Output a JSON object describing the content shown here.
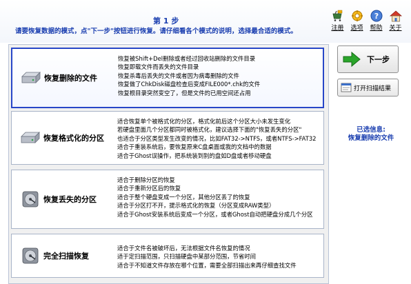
{
  "header": {
    "step_title": "第 1 步",
    "instruction": "请要恢复数据的模式，点\"下一步\"按钮进行恢复。请仔细看各个模式的说明，选择最合适的模式。"
  },
  "toolbar": [
    {
      "label": "注册",
      "icon": "register-icon"
    },
    {
      "label": "选项",
      "icon": "options-icon"
    },
    {
      "label": "帮助",
      "icon": "help-icon"
    },
    {
      "label": "关于",
      "icon": "about-icon"
    }
  ],
  "modes": [
    {
      "name": "恢复删除的文件",
      "selected": true,
      "icon": "hard-disk-icon",
      "desc": [
        "恢复被Shift+Del删除或者经过回收站删除的文件目录",
        "恢复即载文件而丢失的文件目录",
        "恢复杀毒后丢失的文件或者因为病毒删除的文件",
        "恢复做了ChkDisk磁盘检查后变成FILE000*.chk的文件",
        "恢复根目录突然变空了，但是文件的已用空间还占用"
      ]
    },
    {
      "name": "恢复格式化的分区",
      "selected": false,
      "icon": "hard-disk-icon",
      "desc": [
        "适合恢复单个被格式化的分区，格式化前后这个分区大小未发生变化",
        "若硬盘里面几个分区都同时被格式化，建议选择下面的\"恢复丢失的分区\"",
        "也适合于分区类型发生改变的情况，比如FAT32->NTFS，或者NTFS->FAT32",
        "适合于重装系统后，要恢复原来C盘桌面或我的文档中的数据",
        "适合于Ghost误操作，把系统装到别的盘如D盘或者移动硬盘"
      ]
    },
    {
      "name": "恢复丢失的分区",
      "selected": false,
      "icon": "disk-partition-icon",
      "desc": [
        "适合于删除分区的恢复",
        "适合于重新分区后的恢复",
        "适合于整个硬盘变成一个分区，其他分区丢了的恢复",
        "适合于分区打不开，提示格式化的恢复（分区变成RAW类型）",
        "适合于Ghost安装系统后变成一个分区，或者Ghost自动把硬盘分成几个分区"
      ]
    },
    {
      "name": "完全扫描恢复",
      "selected": false,
      "icon": "full-scan-disk-icon",
      "desc": [
        "适合于文件名被破坏后，无法根据文件名恢复的情况",
        "适于定扫描范围，只扫描硬盘中某部分范围，节省时间",
        "适合于不知道文件存放在哪个位置，需要全部扫描出来再仔细查找文件"
      ]
    }
  ],
  "right": {
    "next_label": "下一步",
    "open_label": "打开扫描结果",
    "selected_heading": "已选信息:",
    "selected_value": "恢复删除的文件"
  },
  "colors": {
    "accent": "#1b3fb0",
    "selected_border": "#2746c8",
    "next_arrow": "#2aa52a"
  }
}
